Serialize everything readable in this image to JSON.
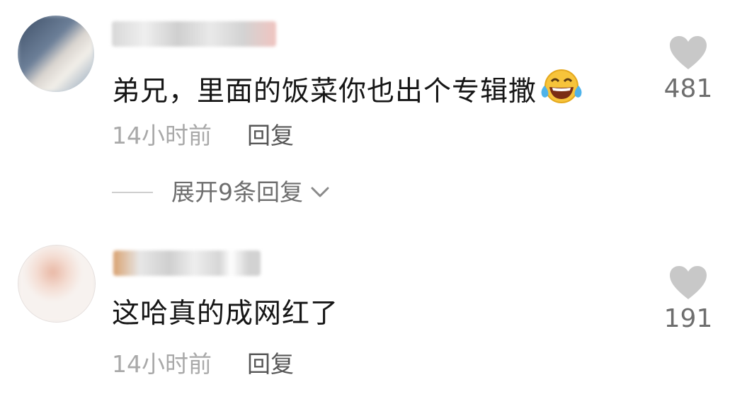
{
  "comments": [
    {
      "text": "弟兄，里面的饭菜你也出个专辑撒",
      "emoji": "laughing-crying-emoji",
      "time": "14小时前",
      "reply_label": "回复",
      "like_count": "481",
      "expand_label": "展开9条回复"
    },
    {
      "text": "这哈真的成网红了",
      "time": "14小时前",
      "reply_label": "回复",
      "like_count": "191"
    }
  ],
  "colors": {
    "text": "#161616",
    "meta": "#a9a9a9",
    "reply": "#565656",
    "heart": "#c8c8c8"
  }
}
